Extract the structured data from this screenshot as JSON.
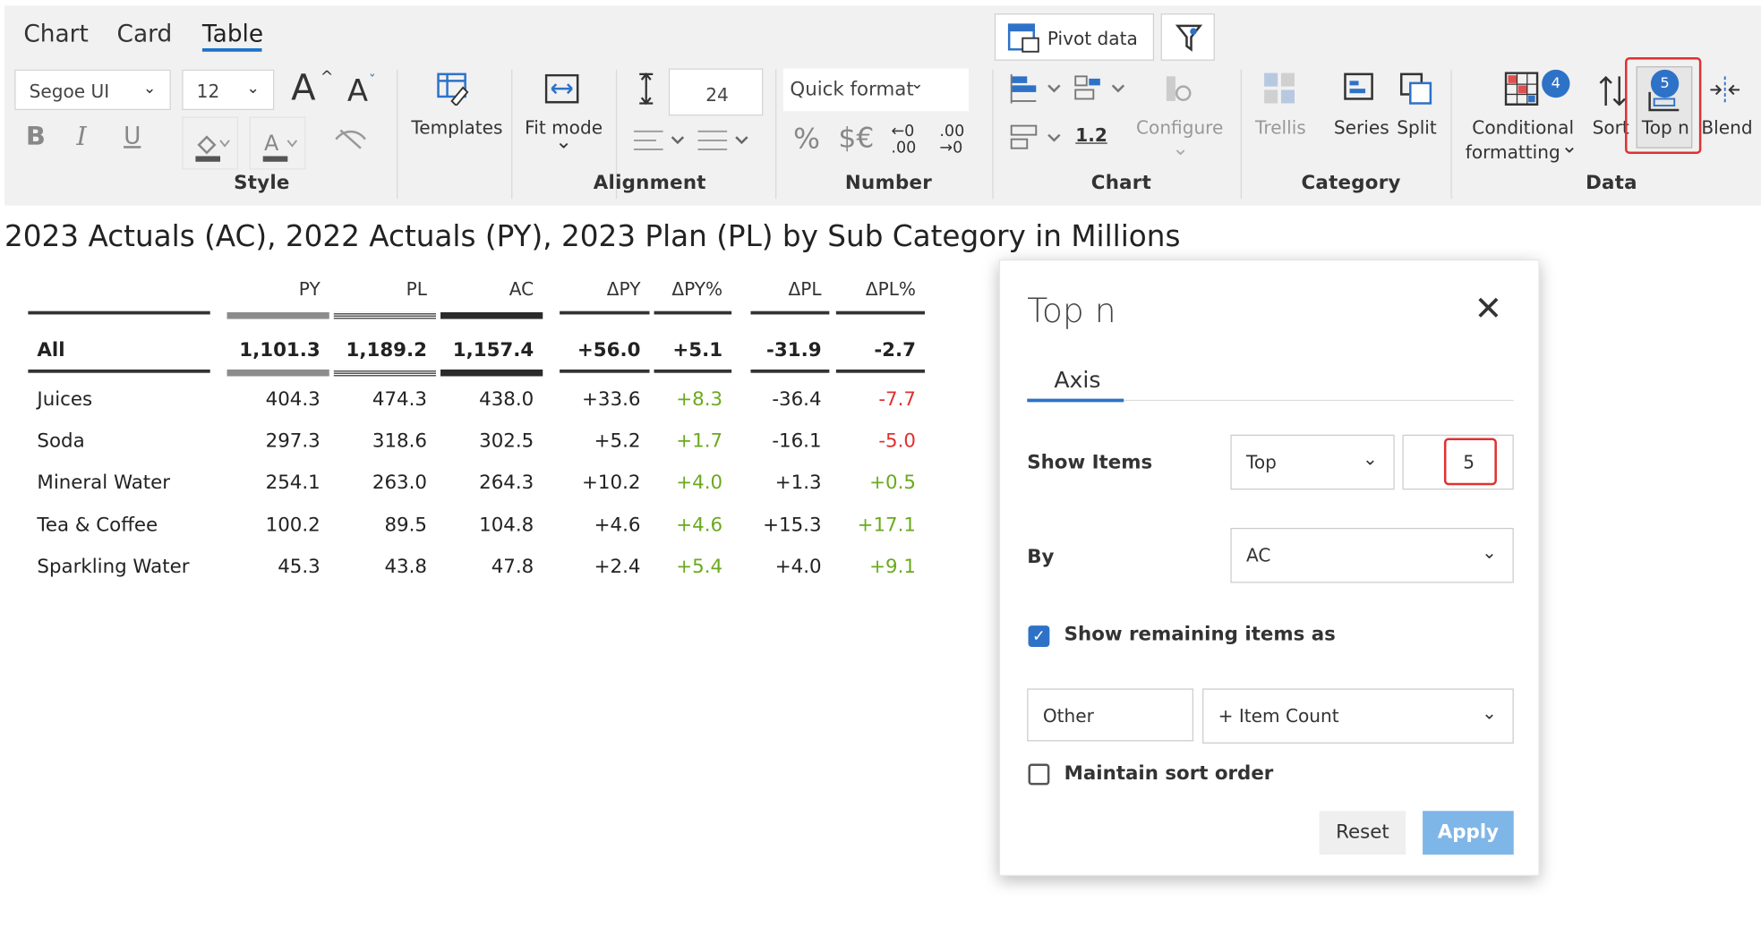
{
  "tabs": [
    "Chart",
    "Card",
    "Table"
  ],
  "style": {
    "font_family_value": "Segoe UI",
    "font_size_value": "12",
    "bold": "B",
    "italic": "I",
    "underline": "U",
    "grow_font": "A",
    "shrink_font": "A",
    "templates_label": "Templates",
    "group_label": "Style"
  },
  "alignment": {
    "fit_mode_label": "Fit mode",
    "row_height_value": "24",
    "group_label": "Alignment"
  },
  "number": {
    "quick_format_label": "Quick format",
    "percent": "%",
    "currency": "$€",
    "dec_less_top": "←0",
    "dec_less_bottom": ".00",
    "dec_more_top": ".00",
    "dec_more_bottom": "→0",
    "group_label": "Number"
  },
  "pivot_data_label": "Pivot data",
  "chart": {
    "value": "1.2",
    "configure_label": "Configure",
    "group_label": "Chart"
  },
  "category": {
    "trellis_label": "Trellis",
    "series_label": "Series",
    "split_label": "Split",
    "group_label": "Category"
  },
  "data_group": {
    "conditional_formatting_line1": "Conditional",
    "conditional_formatting_line2": "formatting",
    "conditional_formatting_badge": "4",
    "sort_label": "Sort",
    "topn_label": "Top n",
    "topn_badge": "5",
    "blend_label": "Blend",
    "group_label": "Data"
  },
  "report_title": "2023 Actuals (AC), 2022 Actuals (PY), 2023 Plan (PL) by Sub Category in Millions",
  "table": {
    "columns": [
      "PY",
      "PL",
      "AC",
      "ΔPY",
      "ΔPY%",
      "ΔPL",
      "ΔPL%"
    ],
    "total": {
      "label": "All",
      "values": [
        "1,101.3",
        "1,189.2",
        "1,157.4",
        "+56.0",
        "+5.1",
        "-31.9",
        "-2.7"
      ]
    },
    "rows": [
      {
        "label": "Juices",
        "values": [
          "404.3",
          "474.3",
          "438.0",
          "+33.6",
          "+8.3",
          "-36.4",
          "-7.7"
        ]
      },
      {
        "label": "Soda",
        "values": [
          "297.3",
          "318.6",
          "302.5",
          "+5.2",
          "+1.7",
          "-16.1",
          "-5.0"
        ]
      },
      {
        "label": "Mineral Water",
        "values": [
          "254.1",
          "263.0",
          "264.3",
          "+10.2",
          "+4.0",
          "+1.3",
          "+0.5"
        ]
      },
      {
        "label": "Tea & Coffee",
        "values": [
          "100.2",
          "89.5",
          "104.8",
          "+4.6",
          "+4.6",
          "+15.3",
          "+17.1"
        ]
      },
      {
        "label": "Sparkling Water",
        "values": [
          "45.3",
          "43.8",
          "47.8",
          "+2.4",
          "+5.4",
          "+4.0",
          "+9.1"
        ]
      }
    ],
    "colors": {
      "positive": "#6aaa1e",
      "negative": "#e03030",
      "py_bar": "#8c8c8c",
      "ac_bar": "#2b2b2b"
    }
  },
  "dialog": {
    "title": "Top n",
    "close": "✕",
    "tab_axis": "Axis",
    "show_items_label": "Show Items",
    "show_items_mode": "Top",
    "show_items_count": "5",
    "by_label": "By",
    "by_value": "AC",
    "show_remaining_label": "Show remaining items as",
    "show_remaining_checked": true,
    "other_value": "Other",
    "item_count_value": "+ Item Count",
    "maintain_sort_label": "Maintain sort order",
    "maintain_sort_checked": false,
    "reset_label": "Reset",
    "apply_label": "Apply"
  }
}
